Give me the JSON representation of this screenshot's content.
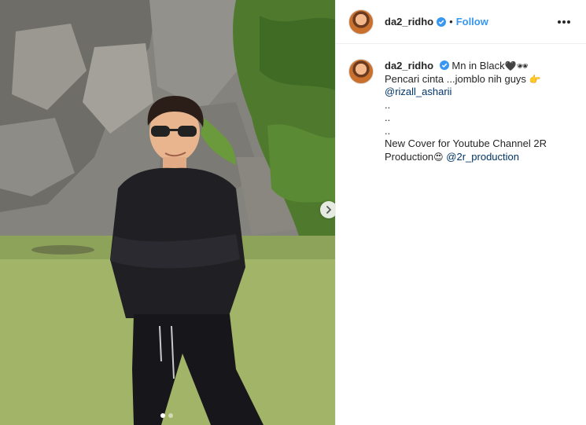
{
  "header": {
    "username": "da2_ridho",
    "separator": "•",
    "follow_label": "Follow"
  },
  "caption": {
    "username": "da2_ridho",
    "line1": "Mn in Black",
    "line1_emoji": "🖤🕶",
    "line2": "Pencari cinta ...jomblo nih guys",
    "line2_emoji": "👉",
    "mention1": "@rizall_asharii",
    "spacer1": "..",
    "spacer2": "..",
    "spacer3": "..",
    "line6": "New Cover for Youtube Channel 2R",
    "line7": "Production",
    "line7_emoji": "😍",
    "mention2": "@2r_production"
  },
  "carousel": {
    "total": 2,
    "current": 1
  },
  "colors": {
    "link": "#3897f0",
    "mention": "#003569",
    "verified": "#3897f0",
    "text": "#262626"
  },
  "icons": [
    "verified-badge-icon",
    "more-options-icon",
    "next-arrow-icon"
  ]
}
